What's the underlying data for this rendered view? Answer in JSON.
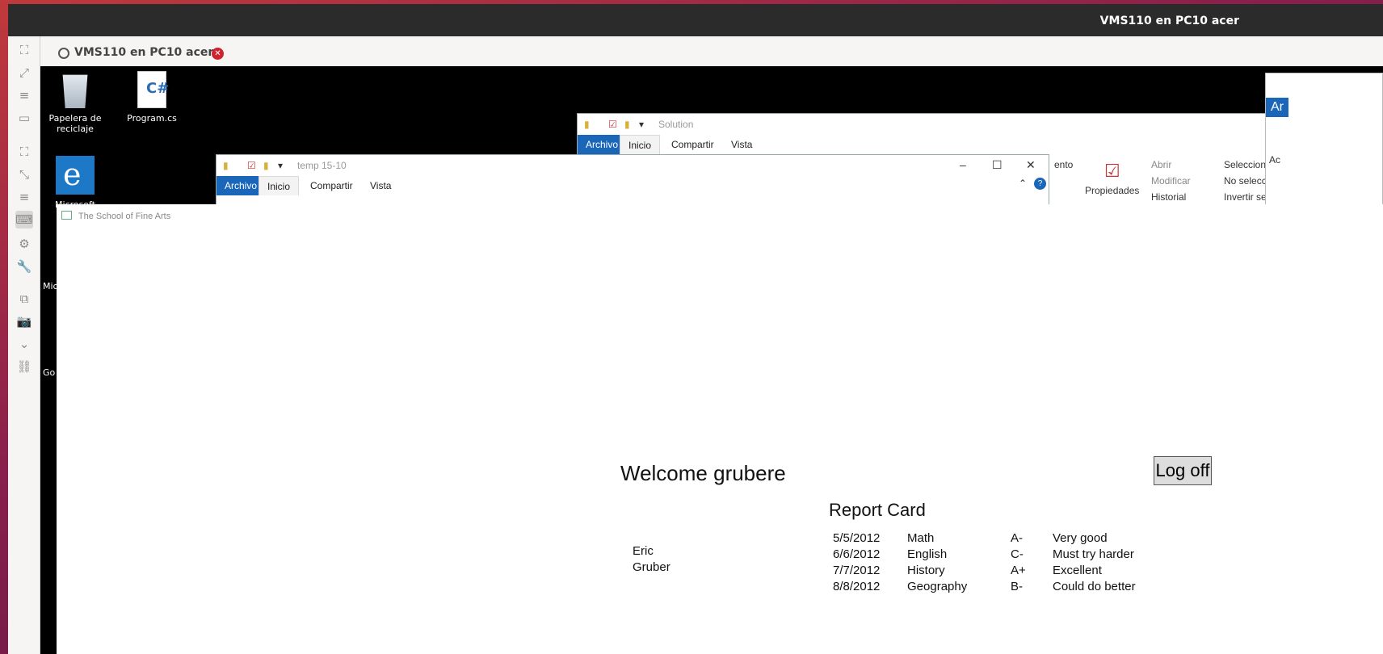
{
  "window": {
    "title": "VMS110 en PC10 acer",
    "tab_label": "VMS110 en PC10 acer"
  },
  "sidebar": {
    "icons": [
      "fit-screen-icon",
      "fullscreen-icon",
      "menu-icon",
      "window-icon",
      "scaled-icon",
      "dynamic-res-icon",
      "menu2-icon",
      "keyboard-icon",
      "settings-icon",
      "tools-icon",
      "new-window-icon",
      "screenshot-icon",
      "minimize-icon",
      "disconnect-icon"
    ]
  },
  "desktop": {
    "icons": [
      {
        "label_line1": "Papelera de",
        "label_line2": "reciclaje"
      },
      {
        "label_line1": "Program.cs",
        "label_line2": ""
      },
      {
        "label_line1": "Microsoft Edge",
        "label_line2": ""
      }
    ],
    "partial_labels": [
      "Mic",
      "Go"
    ]
  },
  "explorer_back": {
    "title": "Solution",
    "tabs": [
      "Archivo",
      "Inicio",
      "Compartir",
      "Vista"
    ]
  },
  "explorer_front": {
    "title": "temp 15-10",
    "tabs": [
      "Archivo",
      "Inicio",
      "Compartir",
      "Vista"
    ]
  },
  "ribbon_right": {
    "item1": "ento",
    "properties": "Propiedades",
    "open": "Abrir",
    "edit": "Modificar",
    "history": "Historial",
    "select_all": "Seleccionar",
    "select_none": "No seleccio",
    "invert": "Invertir sele",
    "far_right_1": "Ar",
    "far_right_2": "Ac"
  },
  "app": {
    "title": "The School of Fine Arts",
    "welcome": "Welcome grubere",
    "logoff": "Log off",
    "report_title": "Report Card",
    "student_first": "Eric",
    "student_last": "Gruber",
    "grades": [
      {
        "date": "5/5/2012",
        "subject": "Math",
        "grade": "A-",
        "comment": "Very good"
      },
      {
        "date": "6/6/2012",
        "subject": "English",
        "grade": "C-",
        "comment": "Must try harder"
      },
      {
        "date": "7/7/2012",
        "subject": "History",
        "grade": "A+",
        "comment": "Excellent"
      },
      {
        "date": "8/8/2012",
        "subject": "Geography",
        "grade": "B-",
        "comment": "Could do better"
      }
    ]
  }
}
